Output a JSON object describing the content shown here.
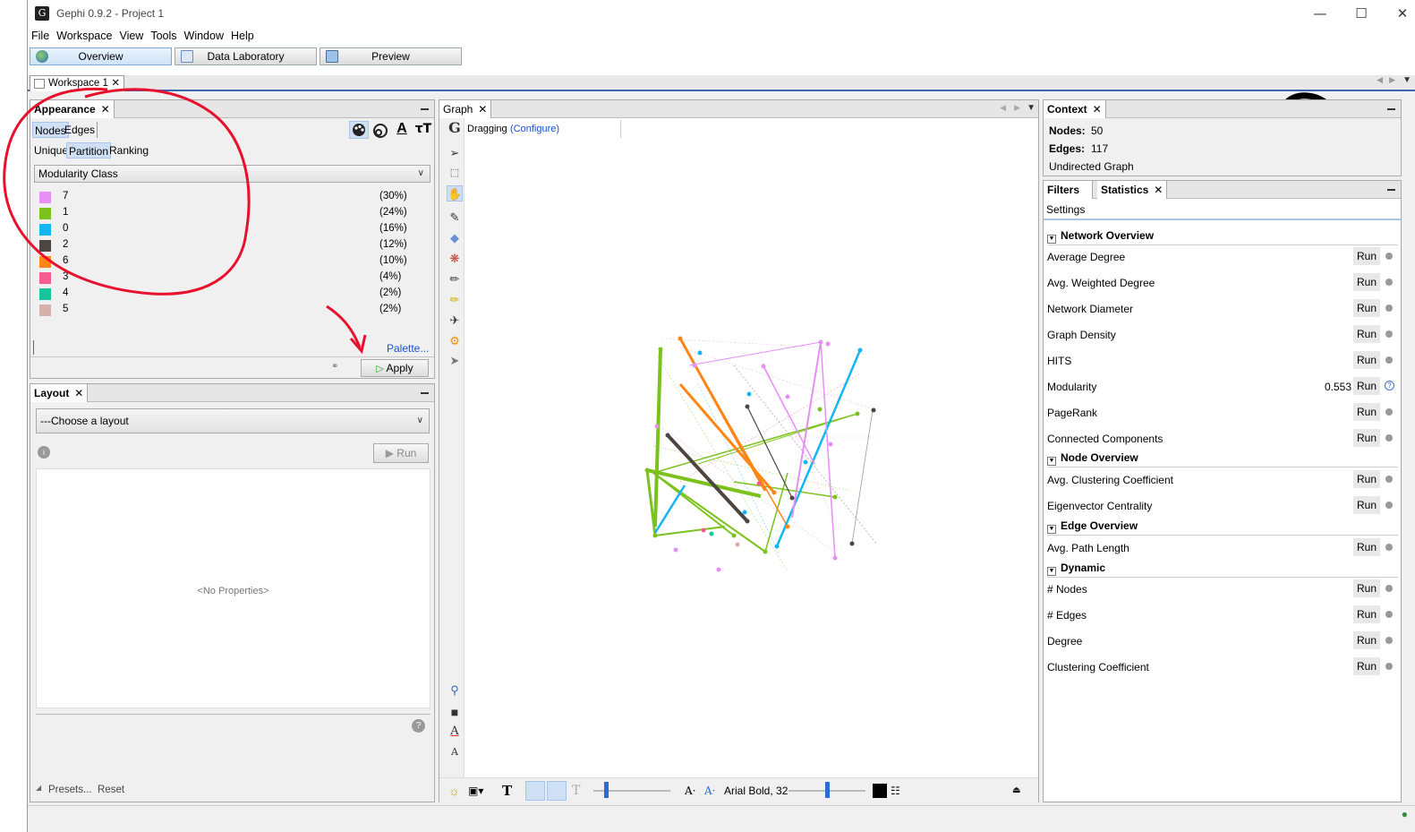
{
  "window": {
    "title": "Gephi 0.9.2 - Project 1"
  },
  "menu": [
    "File",
    "Workspace",
    "View",
    "Tools",
    "Window",
    "Help"
  ],
  "toolbar": {
    "overview": "Overview",
    "data_laboratory": "Data Laboratory",
    "preview": "Preview"
  },
  "workspace_tab": "Workspace 1",
  "appearance": {
    "title": "Appearance",
    "nodes_tab": "Nodes",
    "edges_tab": "Edges",
    "modes": [
      "Unique",
      "Partition",
      "Ranking"
    ],
    "attribute": "Modularity Class",
    "partitions": [
      {
        "label": "7",
        "pct": "(30%)",
        "color": "#e58ff5"
      },
      {
        "label": "1",
        "pct": "(24%)",
        "color": "#7cc21d"
      },
      {
        "label": "0",
        "pct": "(16%)",
        "color": "#12b6f0"
      },
      {
        "label": "2",
        "pct": "(12%)",
        "color": "#4d4540"
      },
      {
        "label": "6",
        "pct": "(10%)",
        "color": "#ff8516"
      },
      {
        "label": "3",
        "pct": "(4%)",
        "color": "#f55c8f"
      },
      {
        "label": "4",
        "pct": "(2%)",
        "color": "#16c59b"
      },
      {
        "label": "5",
        "pct": "(2%)",
        "color": "#d6b0ab"
      }
    ],
    "palette_link": "Palette...",
    "apply": "Apply"
  },
  "layout": {
    "title": "Layout",
    "choose": "---Choose a layout",
    "run": "Run",
    "no_properties": "<No Properties>",
    "presets": "Presets...",
    "reset": "Reset"
  },
  "graph": {
    "title": "Graph",
    "mode": "Dragging",
    "configure": "(Configure)",
    "font": "Arial Bold, 32"
  },
  "context": {
    "title": "Context",
    "nodes_label": "Nodes:",
    "nodes_value": "50",
    "edges_label": "Edges:",
    "edges_value": "117",
    "graph_type": "Undirected Graph"
  },
  "statistics": {
    "filters_tab": "Filters",
    "stats_tab": "Statistics",
    "settings": "Settings",
    "run_label": "Run",
    "sections": [
      {
        "title": "Network Overview",
        "items": [
          {
            "name": "Average Degree"
          },
          {
            "name": "Avg. Weighted Degree"
          },
          {
            "name": "Network Diameter"
          },
          {
            "name": "Graph Density"
          },
          {
            "name": "HITS"
          },
          {
            "name": "Modularity",
            "value": "0.553"
          },
          {
            "name": "PageRank"
          },
          {
            "name": "Connected Components"
          }
        ]
      },
      {
        "title": "Node Overview",
        "items": [
          {
            "name": "Avg. Clustering Coefficient"
          },
          {
            "name": "Eigenvector Centrality"
          }
        ]
      },
      {
        "title": "Edge Overview",
        "items": [
          {
            "name": "Avg. Path Length"
          }
        ]
      },
      {
        "title": "Dynamic",
        "items": [
          {
            "name": "# Nodes"
          },
          {
            "name": "# Edges"
          },
          {
            "name": "Degree"
          },
          {
            "name": "Clustering Coefficient"
          }
        ]
      }
    ]
  }
}
